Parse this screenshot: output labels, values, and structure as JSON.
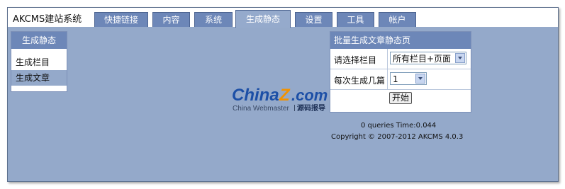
{
  "header": {
    "brand": "AKCMS建站系统",
    "tabs": [
      {
        "label": "快捷链接"
      },
      {
        "label": "内容"
      },
      {
        "label": "系统"
      },
      {
        "label": "生成静态",
        "active": true
      },
      {
        "label": "设置"
      },
      {
        "label": "工具"
      },
      {
        "label": "帐户"
      }
    ]
  },
  "sidebar": {
    "title": "生成静态",
    "items": [
      {
        "label": "生成栏目"
      },
      {
        "label": "生成文章",
        "selected": true
      }
    ]
  },
  "watermark": {
    "brand_left": "China",
    "brand_z": "Z",
    "brand_right": ".com",
    "tagline_left": "China Webmaster",
    "tagline_right": "源码报导"
  },
  "form": {
    "title": "批量生成文章静态页",
    "category_label": "请选择栏目",
    "category_value": "所有栏目+页面",
    "count_label": "每次生成几篇",
    "count_value": "1",
    "submit_label": "开始"
  },
  "footer": {
    "queries": "0 queries Time:0.044",
    "copyright": "Copyright © 2007-2012 AKCMS 4.0.3"
  },
  "colors": {
    "background": "#94a9ca",
    "tab": "#6d87b8",
    "brand_blue": "#1c4fa6",
    "brand_orange": "#f39200"
  }
}
